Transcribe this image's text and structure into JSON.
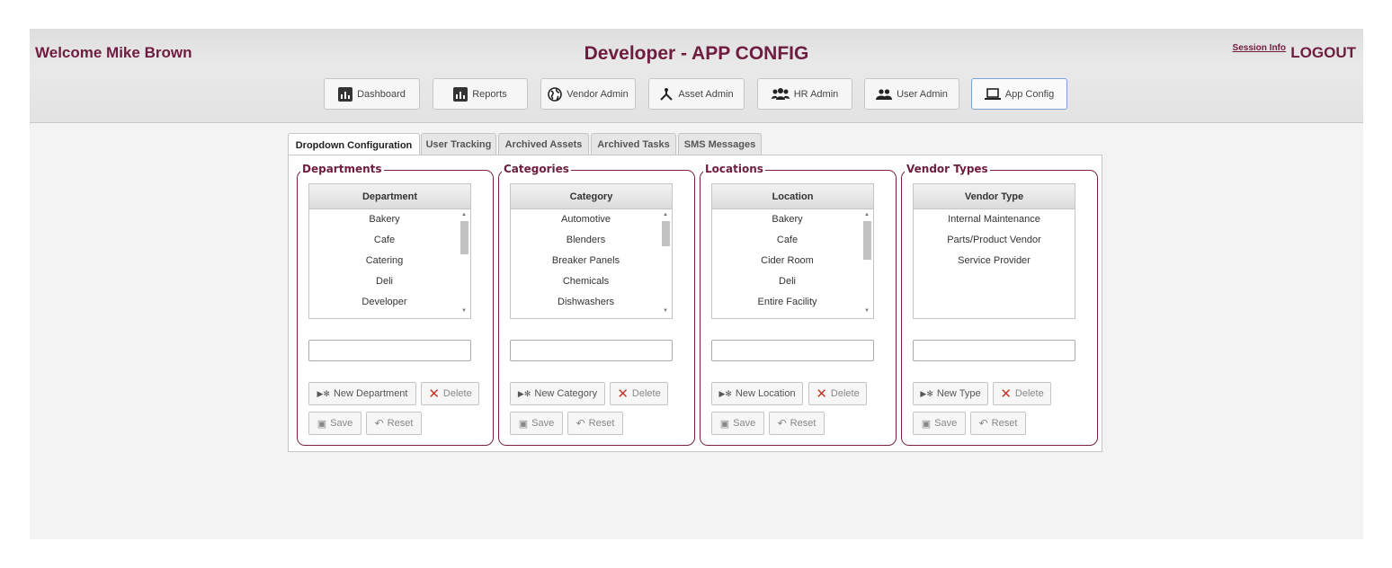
{
  "header": {
    "welcome": "Welcome Mike Brown",
    "title": "Developer - APP CONFIG",
    "session_info": "Session Info",
    "logout": "LOGOUT"
  },
  "nav": [
    {
      "label": "Dashboard",
      "icon": "bar-chart-icon"
    },
    {
      "label": "Reports",
      "icon": "bar-chart-icon"
    },
    {
      "label": "Vendor Admin",
      "icon": "globe-icon"
    },
    {
      "label": "Asset Admin",
      "icon": "network-icon"
    },
    {
      "label": "HR Admin",
      "icon": "group-icon"
    },
    {
      "label": "User Admin",
      "icon": "users-icon"
    },
    {
      "label": "App Config",
      "icon": "laptop-icon",
      "active": true
    }
  ],
  "tabs": [
    {
      "label": "Dropdown Configuration",
      "active": true
    },
    {
      "label": "User Tracking"
    },
    {
      "label": "Archived Assets"
    },
    {
      "label": "Archived Tasks"
    },
    {
      "label": "SMS Messages"
    }
  ],
  "panels": [
    {
      "legend": "Departments",
      "column": "Department",
      "items": [
        "Bakery",
        "Cafe",
        "Catering",
        "Deli",
        "Developer"
      ],
      "input_value": "",
      "new_label": "New Department",
      "delete_label": "Delete",
      "save_label": "Save",
      "reset_label": "Reset"
    },
    {
      "legend": "Categories",
      "column": "Category",
      "items": [
        "Automotive",
        "Blenders",
        "Breaker Panels",
        "Chemicals",
        "Dishwashers"
      ],
      "input_value": "",
      "new_label": "New Category",
      "delete_label": "Delete",
      "save_label": "Save",
      "reset_label": "Reset"
    },
    {
      "legend": "Locations",
      "column": "Location",
      "items": [
        "Bakery",
        "Cafe",
        "Cider Room",
        "Deli",
        "Entire Facility"
      ],
      "input_value": "",
      "new_label": "New Location",
      "delete_label": "Delete",
      "save_label": "Save",
      "reset_label": "Reset"
    },
    {
      "legend": "Vendor Types",
      "column": "Vendor Type",
      "items": [
        "Internal Maintenance",
        "Parts/Product Vendor",
        "Service Provider"
      ],
      "input_value": "",
      "new_label": "New Type",
      "delete_label": "Delete",
      "save_label": "Save",
      "reset_label": "Reset"
    }
  ],
  "colors": {
    "brand": "#6e1c3f",
    "border": "#7b2244",
    "delete": "#c0392b"
  }
}
